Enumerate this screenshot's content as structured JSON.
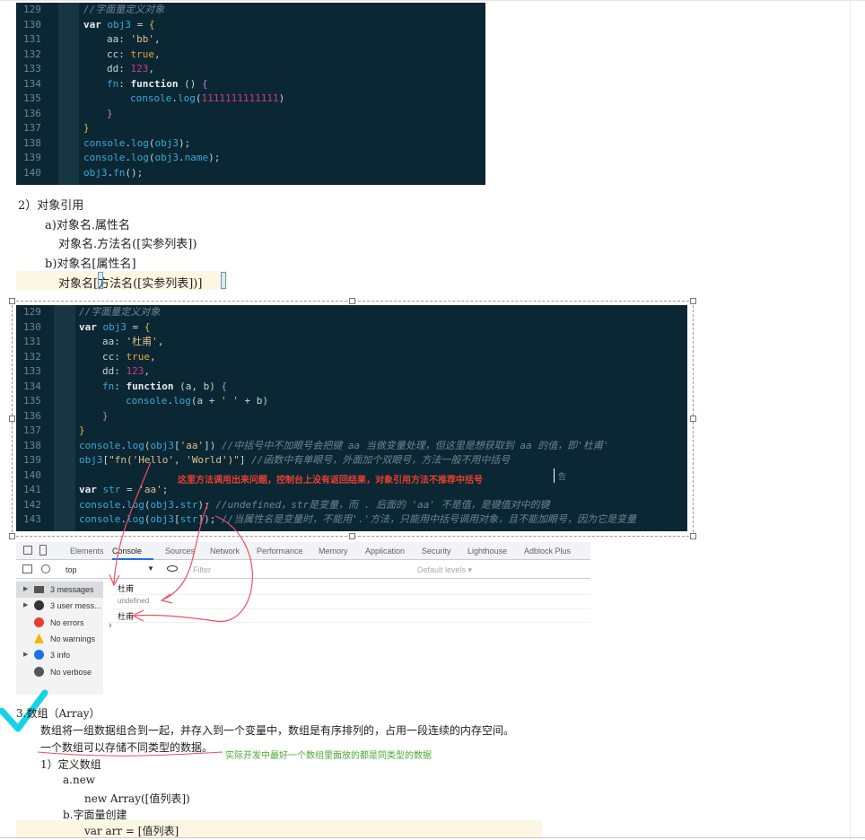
{
  "code_block_1": {
    "lines": [
      {
        "n": "129",
        "indent": 0,
        "tokens": [
          {
            "c": "cmt",
            "t": "//字面量定义对象"
          }
        ]
      },
      {
        "n": "130",
        "indent": 0,
        "tokens": [
          {
            "c": "kw",
            "t": "var "
          },
          {
            "c": "var",
            "t": "obj3"
          },
          {
            "c": "prop",
            "t": " = "
          },
          {
            "c": "br",
            "t": "{"
          }
        ]
      },
      {
        "n": "131",
        "indent": 1,
        "tokens": [
          {
            "c": "prop",
            "t": "aa: "
          },
          {
            "c": "str",
            "t": "'bb'"
          },
          {
            "c": "prop",
            "t": ","
          }
        ]
      },
      {
        "n": "132",
        "indent": 1,
        "tokens": [
          {
            "c": "prop",
            "t": "cc: "
          },
          {
            "c": "bool",
            "t": "true"
          },
          {
            "c": "prop",
            "t": ","
          }
        ]
      },
      {
        "n": "133",
        "indent": 1,
        "tokens": [
          {
            "c": "prop",
            "t": "dd: "
          },
          {
            "c": "num",
            "t": "123"
          },
          {
            "c": "prop",
            "t": ","
          }
        ]
      },
      {
        "n": "134",
        "indent": 1,
        "tokens": [
          {
            "c": "fn",
            "t": "fn"
          },
          {
            "c": "prop",
            "t": ": "
          },
          {
            "c": "kw",
            "t": "function"
          },
          {
            "c": "prop",
            "t": " () "
          },
          {
            "c": "brp",
            "t": "{"
          }
        ]
      },
      {
        "n": "135",
        "indent": 2,
        "tokens": [
          {
            "c": "var",
            "t": "console"
          },
          {
            "c": "prop",
            "t": "."
          },
          {
            "c": "fn",
            "t": "log"
          },
          {
            "c": "prop",
            "t": "("
          },
          {
            "c": "num",
            "t": "1111111111111"
          },
          {
            "c": "prop",
            "t": ")"
          }
        ]
      },
      {
        "n": "136",
        "indent": 1,
        "tokens": [
          {
            "c": "brp",
            "t": "}"
          }
        ]
      },
      {
        "n": "137",
        "indent": 0,
        "tokens": [
          {
            "c": "br",
            "t": "}"
          }
        ]
      },
      {
        "n": "138",
        "indent": 0,
        "tokens": [
          {
            "c": "var",
            "t": "console"
          },
          {
            "c": "prop",
            "t": "."
          },
          {
            "c": "fn",
            "t": "log"
          },
          {
            "c": "prop",
            "t": "("
          },
          {
            "c": "var",
            "t": "obj3"
          },
          {
            "c": "prop",
            "t": ");"
          }
        ]
      },
      {
        "n": "139",
        "indent": 0,
        "tokens": [
          {
            "c": "var",
            "t": "console"
          },
          {
            "c": "prop",
            "t": "."
          },
          {
            "c": "fn",
            "t": "log"
          },
          {
            "c": "prop",
            "t": "("
          },
          {
            "c": "var",
            "t": "obj3"
          },
          {
            "c": "prop",
            "t": "."
          },
          {
            "c": "fn",
            "t": "name"
          },
          {
            "c": "prop",
            "t": ");"
          }
        ]
      },
      {
        "n": "140",
        "indent": 0,
        "tokens": [
          {
            "c": "var",
            "t": "obj3"
          },
          {
            "c": "prop",
            "t": "."
          },
          {
            "c": "fn",
            "t": "fn"
          },
          {
            "c": "prop",
            "t": "();"
          }
        ]
      }
    ]
  },
  "doc_text_1": {
    "heading": "2）对象引用",
    "a_title": "a)对象名.属性名",
    "a_sub": "对象名.方法名([实参列表])",
    "b_title": "b)对象名[属性名]",
    "b_sub": "对象名[方法名([实参列表])]"
  },
  "code_block_2": {
    "lines": [
      {
        "n": "129",
        "indent": 0,
        "tokens": [
          {
            "c": "cmt",
            "t": "//字面量定义对象"
          }
        ]
      },
      {
        "n": "130",
        "indent": 0,
        "tokens": [
          {
            "c": "kw",
            "t": "var "
          },
          {
            "c": "var",
            "t": "obj3"
          },
          {
            "c": "prop",
            "t": " = "
          },
          {
            "c": "br",
            "t": "{"
          }
        ]
      },
      {
        "n": "131",
        "indent": 1,
        "tokens": [
          {
            "c": "prop",
            "t": "aa: "
          },
          {
            "c": "str",
            "t": "'杜甫'"
          },
          {
            "c": "prop",
            "t": ","
          }
        ]
      },
      {
        "n": "132",
        "indent": 1,
        "tokens": [
          {
            "c": "prop",
            "t": "cc: "
          },
          {
            "c": "bool",
            "t": "true"
          },
          {
            "c": "prop",
            "t": ","
          }
        ]
      },
      {
        "n": "133",
        "indent": 1,
        "tokens": [
          {
            "c": "prop",
            "t": "dd: "
          },
          {
            "c": "num",
            "t": "123"
          },
          {
            "c": "prop",
            "t": ","
          }
        ]
      },
      {
        "n": "134",
        "indent": 1,
        "tokens": [
          {
            "c": "fn",
            "t": "fn"
          },
          {
            "c": "prop",
            "t": ": "
          },
          {
            "c": "kw",
            "t": "function"
          },
          {
            "c": "prop",
            "t": " (a, b) "
          },
          {
            "c": "brp",
            "t": "{"
          }
        ]
      },
      {
        "n": "135",
        "indent": 2,
        "tokens": [
          {
            "c": "var",
            "t": "console"
          },
          {
            "c": "prop",
            "t": "."
          },
          {
            "c": "fn",
            "t": "log"
          },
          {
            "c": "prop",
            "t": "(a + "
          },
          {
            "c": "str",
            "t": "' '"
          },
          {
            "c": "prop",
            "t": " + b)"
          }
        ]
      },
      {
        "n": "136",
        "indent": 1,
        "tokens": [
          {
            "c": "brp",
            "t": "}"
          }
        ]
      },
      {
        "n": "137",
        "indent": 0,
        "tokens": [
          {
            "c": "br",
            "t": "}"
          }
        ]
      },
      {
        "n": "138",
        "indent": 0,
        "tokens": [
          {
            "c": "var",
            "t": "console"
          },
          {
            "c": "prop",
            "t": "."
          },
          {
            "c": "fn",
            "t": "log"
          },
          {
            "c": "prop",
            "t": "("
          },
          {
            "c": "var",
            "t": "obj3"
          },
          {
            "c": "prop",
            "t": "["
          },
          {
            "c": "str",
            "t": "'aa'"
          },
          {
            "c": "prop",
            "t": "]) "
          },
          {
            "c": "cmt",
            "t": "//中括号中不加眼号会把键 aa 当做变量处理，但这里是想获取到 aa 的值，即'杜甫'"
          }
        ]
      },
      {
        "n": "139",
        "indent": 0,
        "tokens": [
          {
            "c": "var",
            "t": "obj3"
          },
          {
            "c": "prop",
            "t": "["
          },
          {
            "c": "str",
            "t": "\"fn('Hello', 'World')\""
          },
          {
            "c": "prop",
            "t": "] "
          },
          {
            "c": "cmt",
            "t": "//函数中有单眼号，外面加个双眼号，方法一般不用中括号"
          }
        ]
      },
      {
        "n": "140",
        "indent": 0,
        "tokens": []
      },
      {
        "n": "141",
        "indent": 0,
        "tokens": [
          {
            "c": "kw",
            "t": "var "
          },
          {
            "c": "var",
            "t": "str"
          },
          {
            "c": "prop",
            "t": " = "
          },
          {
            "c": "str",
            "t": "'aa'"
          },
          {
            "c": "prop",
            "t": ";"
          }
        ]
      },
      {
        "n": "142",
        "indent": 0,
        "tokens": [
          {
            "c": "var",
            "t": "console"
          },
          {
            "c": "prop",
            "t": "."
          },
          {
            "c": "fn",
            "t": "log"
          },
          {
            "c": "prop",
            "t": "("
          },
          {
            "c": "var",
            "t": "obj3"
          },
          {
            "c": "prop",
            "t": "."
          },
          {
            "c": "var",
            "t": "str"
          },
          {
            "c": "prop",
            "t": "); "
          },
          {
            "c": "cmt",
            "t": "//undefined，str是变量，而 . 后面的 'aa' 不是值，是键值对中的键"
          }
        ]
      },
      {
        "n": "143",
        "indent": 0,
        "tokens": [
          {
            "c": "var",
            "t": "console"
          },
          {
            "c": "prop",
            "t": "."
          },
          {
            "c": "fn",
            "t": "log"
          },
          {
            "c": "prop",
            "t": "("
          },
          {
            "c": "var",
            "t": "obj3"
          },
          {
            "c": "prop",
            "t": "["
          },
          {
            "c": "var",
            "t": "str"
          },
          {
            "c": "prop",
            "t": "]); "
          },
          {
            "c": "cmt",
            "t": "//当属性名是变量时，不能用'.'方法，只能用中括号调用对象，且不能加眼号，因为它是变量"
          }
        ]
      }
    ],
    "annotation": "这里方法调用出来问题，控制台上没有返回结果，对象引用方法不推荐中括号",
    "annotation_tail": "告"
  },
  "devtools": {
    "tabs": [
      "Elements",
      "Console",
      "Sources",
      "Network",
      "Performance",
      "Memory",
      "Application",
      "Security",
      "Lighthouse",
      "Adblock Plus"
    ],
    "active_tab": "Console",
    "context": "top",
    "filter_placeholder": "Filter",
    "levels": "Default levels ▾",
    "sidebar": [
      {
        "label": "3 messages",
        "icon": "list-icon",
        "color": "#555555",
        "arrow": "▶",
        "selected": true
      },
      {
        "label": "3 user mess...",
        "icon": "user-icon",
        "color": "#333333",
        "arrow": "▶",
        "selected": false
      },
      {
        "label": "No errors",
        "icon": "error-icon",
        "color": "#e8402f",
        "arrow": "",
        "selected": false
      },
      {
        "label": "No warnings",
        "icon": "warning-icon",
        "color": "#f2b705",
        "arrow": "",
        "selected": false
      },
      {
        "label": "3 info",
        "icon": "info-icon",
        "color": "#1a73e8",
        "arrow": "▶",
        "selected": false
      },
      {
        "label": "No verbose",
        "icon": "bug-icon",
        "color": "#555555",
        "arrow": "",
        "selected": false
      }
    ],
    "console_lines": [
      "杜甫",
      "undefined",
      "杜甫"
    ],
    "prompt": "›"
  },
  "doc_text_2": {
    "heading": "3.数组（Array）",
    "p1": "数组将一组数据组合到一起，并存入到一个变量中，数组是有序排列的，占用一段连续的内存空间。",
    "p2": "一个数组可以存储不同类型的数据。",
    "p2_note": "实际开发中最好一个数组里面放的都是同类型的数据",
    "s1": "1）定义数组",
    "s1a": "a.new",
    "s1a_code": "new Array([值列表])",
    "s1b": "b.字面量创建",
    "s1b_code": "var arr = [值列表]"
  }
}
